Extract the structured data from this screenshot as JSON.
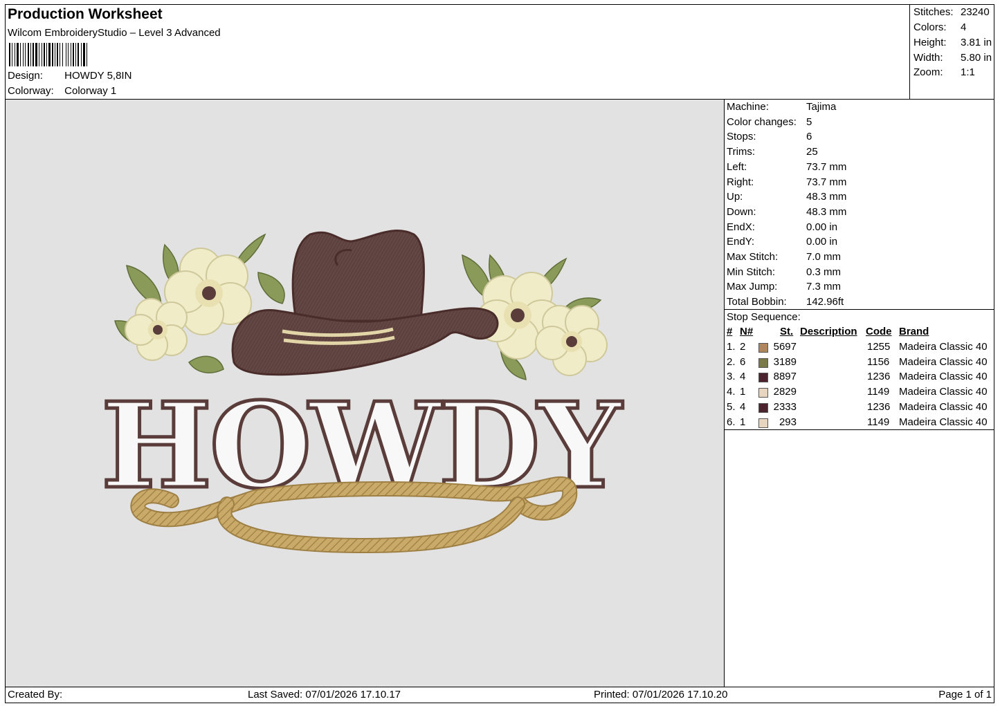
{
  "header": {
    "title": "Production Worksheet",
    "subtitle": "Wilcom EmbroideryStudio – Level 3 Advanced",
    "design_label": "Design:",
    "design_value": "HOWDY 5,8IN",
    "colorway_label": "Colorway:",
    "colorway_value": "Colorway 1"
  },
  "summary": [
    {
      "label": "Stitches:",
      "value": "23240"
    },
    {
      "label": "Colors:",
      "value": "4"
    },
    {
      "label": "Height:",
      "value": "3.81 in"
    },
    {
      "label": "Width:",
      "value": "5.80 in"
    },
    {
      "label": "Zoom:",
      "value": "1:1"
    }
  ],
  "machine_info": [
    {
      "label": "Machine:",
      "value": "Tajima"
    },
    {
      "label": "Color changes:",
      "value": "5"
    },
    {
      "label": "Stops:",
      "value": "6"
    },
    {
      "label": "Trims:",
      "value": "25"
    },
    {
      "label": "Left:",
      "value": "73.7 mm"
    },
    {
      "label": "Right:",
      "value": "73.7 mm"
    },
    {
      "label": "Up:",
      "value": "48.3 mm"
    },
    {
      "label": "Down:",
      "value": "48.3 mm"
    },
    {
      "label": "EndX:",
      "value": "0.00 in"
    },
    {
      "label": "EndY:",
      "value": "0.00 in"
    },
    {
      "label": "Max Stitch:",
      "value": "7.0 mm"
    },
    {
      "label": "Min Stitch:",
      "value": "0.3 mm"
    },
    {
      "label": "Max Jump:",
      "value": "7.3 mm"
    },
    {
      "label": "Total Bobbin:",
      "value": "142.96ft"
    }
  ],
  "stop_sequence": {
    "title": "Stop Sequence:",
    "headers": {
      "num": "#",
      "n": "N#",
      "st": "St.",
      "description": "Description",
      "code": "Code",
      "brand": "Brand"
    },
    "rows": [
      {
        "num": "1.",
        "n": "2",
        "color": "#b08660",
        "st": "5697",
        "code": "1255",
        "brand": "Madeira Classic 40"
      },
      {
        "num": "2.",
        "n": "6",
        "color": "#7a7a48",
        "st": "3189",
        "code": "1156",
        "brand": "Madeira Classic 40"
      },
      {
        "num": "3.",
        "n": "4",
        "color": "#4a2530",
        "st": "8897",
        "code": "1236",
        "brand": "Madeira Classic 40"
      },
      {
        "num": "4.",
        "n": "1",
        "color": "#e8d5c0",
        "st": "2829",
        "code": "1149",
        "brand": "Madeira Classic 40"
      },
      {
        "num": "5.",
        "n": "4",
        "color": "#4a2530",
        "st": "2333",
        "code": "1236",
        "brand": "Madeira Classic 40"
      },
      {
        "num": "6.",
        "n": "1",
        "color": "#e8d5c0",
        "st": "293",
        "code": "1149",
        "brand": "Madeira Classic 40"
      }
    ]
  },
  "design": {
    "text": "HOWDY",
    "colors": {
      "hat": "#5a3d3a",
      "leaf": "#8a9a58",
      "flower": "#f0ecc8",
      "rope": "#c9aa68",
      "outline": "#5a3d3a"
    }
  },
  "footer": {
    "created_by": "Created By:",
    "last_saved": "Last Saved: 07/01/2026 17.10.17",
    "printed": "Printed: 07/01/2026 17.10.20",
    "page": "Page 1 of 1"
  }
}
